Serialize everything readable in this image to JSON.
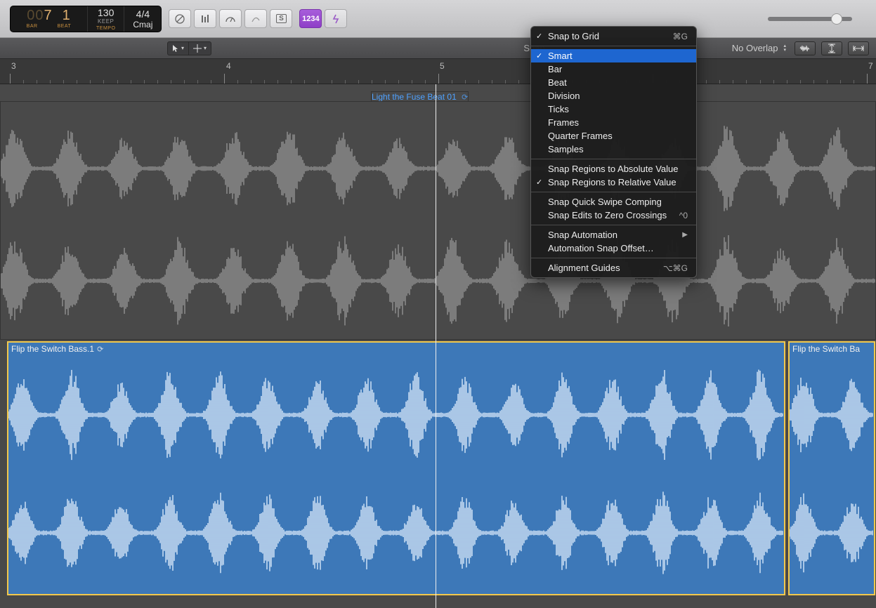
{
  "lcd": {
    "bar_dim": "00",
    "bar": "7",
    "beat": "1",
    "bar_label": "BAR",
    "beat_label": "BEAT",
    "tempo": "130",
    "tempo_sub": "KEEP",
    "tempo_label": "TEMPO",
    "sig": "4/4",
    "key": "Cmaj"
  },
  "toolbar": {
    "num_btn": "1234"
  },
  "toolbar2": {
    "snap_label": "Snap",
    "overlap": "No Overlap"
  },
  "ruler": {
    "marks": [
      "3",
      "4",
      "5",
      "7"
    ]
  },
  "regions": {
    "top_name": "Light the Fuse Beat 01",
    "bass1": "Flip the Switch Bass.1",
    "bass2": "Flip the Switch Ba"
  },
  "menu": {
    "header": "Snap to Grid",
    "header_kb": "⌘G",
    "items1": [
      "Smart",
      "Bar",
      "Beat",
      "Division",
      "Ticks",
      "Frames",
      "Quarter Frames",
      "Samples"
    ],
    "abs": "Snap Regions to Absolute Value",
    "rel": "Snap Regions to Relative Value",
    "comp": "Snap Quick Swipe Comping",
    "zero": "Snap Edits to Zero Crossings",
    "zero_kb": "^0",
    "auto": "Snap Automation",
    "offset": "Automation Snap Offset…",
    "guides": "Alignment Guides",
    "guides_kb": "⌥⌘G"
  }
}
